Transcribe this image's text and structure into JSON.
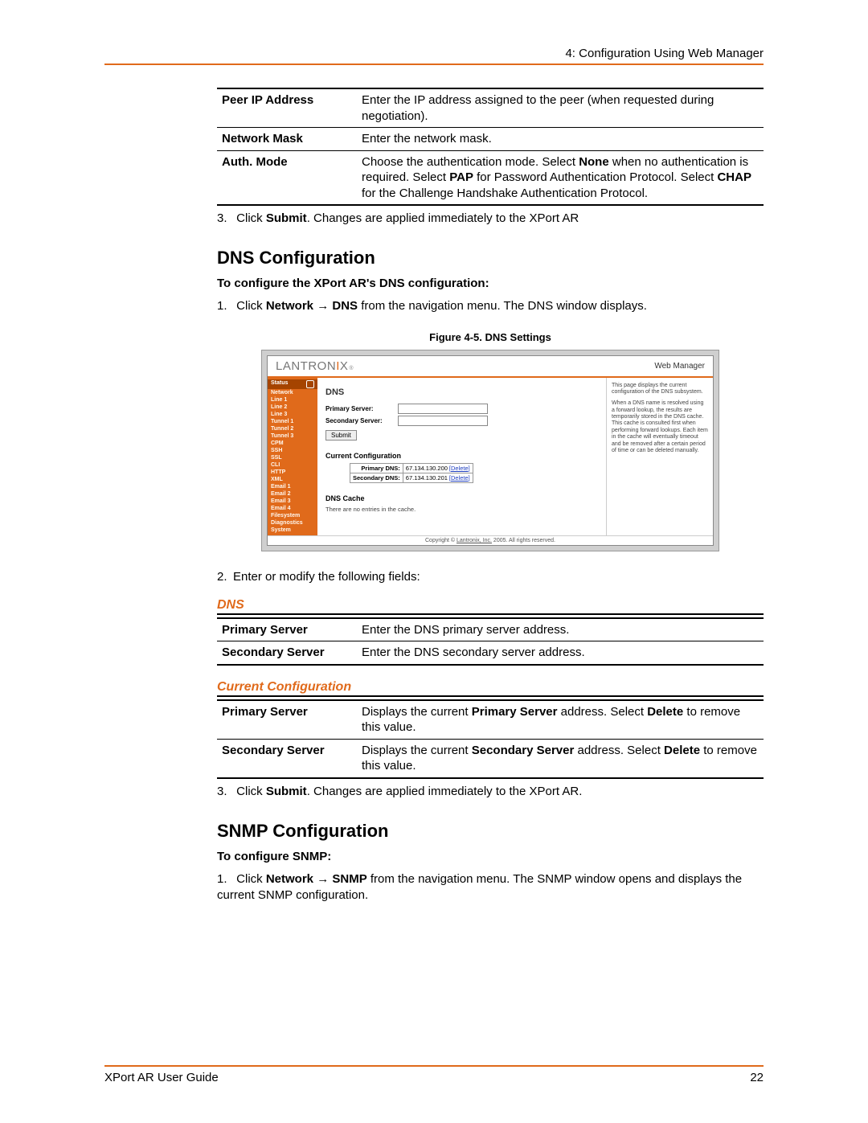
{
  "header": {
    "chapter": "4: Configuration Using Web Manager"
  },
  "peer_table": [
    {
      "label": "Peer IP Address",
      "desc": "Enter the IP address assigned to the peer (when requested during negotiation)."
    },
    {
      "label": "Network Mask",
      "desc": "Enter the network mask."
    },
    {
      "label": "Auth. Mode",
      "desc_parts": [
        "Choose the authentication mode.  Select ",
        "None",
        " when no authentication is required.  Select ",
        "PAP",
        " for Password Authentication Protocol. Select ",
        "CHAP",
        " for the Challenge Handshake Authentication Protocol."
      ]
    }
  ],
  "step_after_peer": {
    "num": "3.",
    "parts": [
      "Click ",
      "Submit",
      ". Changes are applied immediately to the XPort AR"
    ]
  },
  "dns": {
    "heading": "DNS Configuration",
    "sub": "To configure the XPort AR's DNS configuration:",
    "step1": {
      "num": "1.",
      "parts": [
        "Click ",
        "Network",
        " → ",
        "DNS",
        " from the navigation menu. The DNS window displays."
      ]
    },
    "caption": "Figure 4-5. DNS Settings",
    "step2": {
      "num": "2.",
      "text": "Enter or modify the following fields:"
    },
    "table1_title": "DNS",
    "table1": [
      {
        "label": "Primary Server",
        "desc": "Enter the DNS primary server address."
      },
      {
        "label": "Secondary Server",
        "desc": "Enter the DNS secondary server address."
      }
    ],
    "table2_title": "Current Configuration",
    "table2": [
      {
        "label": "Primary Server",
        "parts": [
          "Displays the current ",
          "Primary Server",
          " address. Select ",
          "Delete",
          " to remove this value."
        ]
      },
      {
        "label": "Secondary Server",
        "parts": [
          "Displays the current ",
          "Secondary Server",
          " address. Select ",
          "Delete",
          " to remove this value."
        ]
      }
    ],
    "step3": {
      "num": "3.",
      "parts": [
        "Click ",
        "Submit",
        ". Changes are applied immediately to the XPort AR."
      ]
    }
  },
  "snmp": {
    "heading": "SNMP Configuration",
    "sub": "To configure SNMP:",
    "step1": {
      "num": "1.",
      "parts": [
        "Click ",
        "Network",
        " → ",
        "SNMP",
        " from the navigation menu. The SNMP window opens and displays the current SNMP configuration."
      ]
    }
  },
  "figure": {
    "logo_a": "LANTRON",
    "logo_b": "I",
    "logo_c": "X",
    "tm": "®",
    "web_manager": "Web Manager",
    "nav_status": "Status",
    "nav": [
      "Network",
      "Line 1",
      "Line 2",
      "Line 3",
      "Tunnel 1",
      "Tunnel 2",
      "Tunnel 3",
      "CPM",
      "SSH",
      "SSL",
      "CLI",
      "HTTP",
      "XML",
      "Email 1",
      "Email 2",
      "Email 3",
      "Email 4",
      "Filesystem",
      "Diagnostics",
      "System"
    ],
    "title": "DNS",
    "primary_label": "Primary Server:",
    "secondary_label": "Secondary Server:",
    "submit": "Submit",
    "current_cfg": "Current Configuration",
    "cfg_rows": [
      {
        "k": "Primary DNS:",
        "v": "67.134.130.200",
        "a": "[Delete]"
      },
      {
        "k": "Secondary DNS:",
        "v": "67.134.130.201",
        "a": "[Delete]"
      }
    ],
    "cache_title": "DNS Cache",
    "cache_msg": "There are no entries in the cache.",
    "right_p1": "This page displays the current configuration of the DNS subsystem.",
    "right_p2": "When a DNS name is resolved using a forward lookup, the results are temporarily stored in the DNS cache. This cache is consulted first when performing forward lookups. Each item in the cache will eventually timeout and be removed after a certain period of time or can be deleted manually.",
    "copyright_a": "Copyright © ",
    "copyright_link": "Lantronix, Inc.",
    "copyright_b": " 2005. All rights reserved."
  },
  "footer": {
    "left": "XPort AR User Guide",
    "right": "22"
  }
}
